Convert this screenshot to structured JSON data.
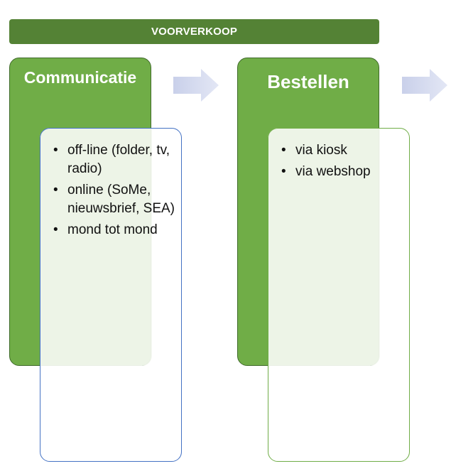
{
  "banner": {
    "label": "VOORVERKOOP"
  },
  "stages": [
    {
      "title": "Communicatie",
      "items": [
        "off-line (folder, tv, radio)",
        "online (SoMe, nieuwsbrief, SEA)",
        "mond tot mond"
      ]
    },
    {
      "title": "Bestellen",
      "items": [
        "via kiosk",
        "via webshop"
      ]
    }
  ],
  "colors": {
    "banner": "#548235",
    "stage": "#70ad47",
    "arrow": "#d6dcef",
    "panel1_border": "#4472c4",
    "panel2_border": "#70ad47"
  }
}
